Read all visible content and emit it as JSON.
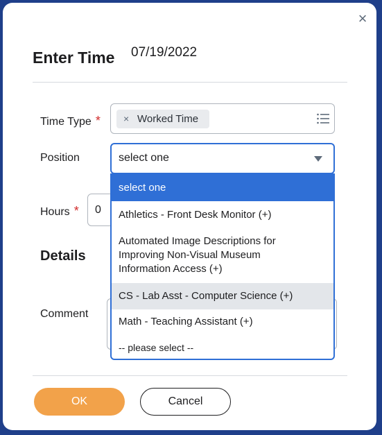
{
  "dialog": {
    "title": "Enter Time",
    "date": "07/19/2022",
    "close_icon": "×"
  },
  "time_type": {
    "label": "Time Type",
    "required_mark": "*",
    "pill_remove_icon": "×",
    "value": "Worked Time",
    "list_icon": "list-icon"
  },
  "position": {
    "label": "Position",
    "selected": "select one",
    "options": [
      "select one",
      "Athletics - Front Desk Monitor (+)",
      "Automated Image Descriptions for Improving Non-Visual Museum Information Access (+)",
      "CS - Lab Asst - Computer Science (+)",
      "Math - Teaching Assistant (+)",
      "-- please select --"
    ],
    "highlighted_option": "select one",
    "hovered_option": "CS - Lab Asst - Computer Science (+)"
  },
  "hours": {
    "label": "Hours",
    "required_mark": "*",
    "value": "0"
  },
  "details": {
    "heading": "Details",
    "comment_label": "Comment"
  },
  "footer": {
    "ok_label": "OK",
    "cancel_label": "Cancel"
  },
  "colors": {
    "accent_blue": "#2f6fd6",
    "ok_orange": "#f2a24a",
    "required_red": "#d12a2a",
    "backdrop": "#1f3f8a"
  }
}
